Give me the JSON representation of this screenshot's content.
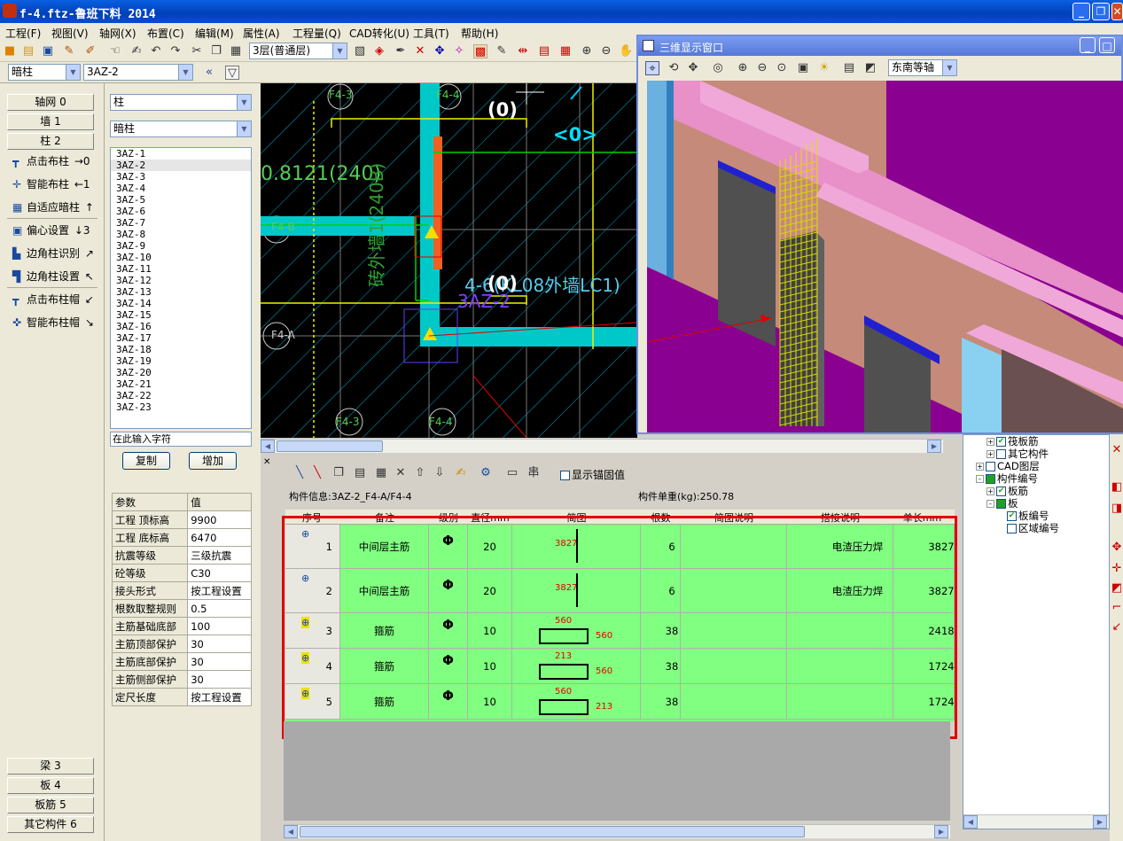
{
  "window": {
    "title": "f-4.ftz-鲁班下料 2014",
    "minimize": "_",
    "restore": "❐",
    "close": "✕"
  },
  "menu": [
    "工程(F)",
    "视图(V)",
    "轴网(X)",
    "布置(C)",
    "编辑(M)",
    "属性(A)",
    "工程量(Q)",
    "CAD转化(U)",
    "工具(T)",
    "帮助(H)"
  ],
  "toolbar": {
    "floor_select": "3层(普通层)"
  },
  "toolbar2": {
    "type_select": "暗柱",
    "name_select": "3AZ-2"
  },
  "left_nav": {
    "top": [
      {
        "label": "轴网 0"
      },
      {
        "label": "墙 1"
      },
      {
        "label": "柱 2"
      }
    ],
    "commands": [
      {
        "label": "点击布柱",
        "key": "→0"
      },
      {
        "label": "智能布柱",
        "key": "←1"
      },
      {
        "label": "自适应暗柱",
        "key": "↑"
      },
      {
        "label": "偏心设置",
        "key": "↓3"
      },
      {
        "label": "边角柱识别",
        "key": "↗"
      },
      {
        "label": "边角柱设置",
        "key": "↖"
      },
      {
        "label": "点击布柱帽",
        "key": "↙"
      },
      {
        "label": "智能布柱帽",
        "key": "↘"
      }
    ],
    "bottom": [
      {
        "label": "梁 3"
      },
      {
        "label": "板 4"
      },
      {
        "label": "板筋 5"
      },
      {
        "label": "其它构件 6"
      }
    ]
  },
  "component": {
    "category": "柱",
    "subtype": "暗柱",
    "list": [
      "3AZ-1",
      "3AZ-2",
      "3AZ-3",
      "3AZ-4",
      "3AZ-5",
      "3AZ-6",
      "3AZ-7",
      "3AZ-8",
      "3AZ-9",
      "3AZ-10",
      "3AZ-11",
      "3AZ-12",
      "3AZ-13",
      "3AZ-14",
      "3AZ-15",
      "3AZ-16",
      "3AZ-17",
      "3AZ-18",
      "3AZ-19",
      "3AZ-20",
      "3AZ-21",
      "3AZ-22",
      "3AZ-23"
    ],
    "selected_index": 1,
    "input_placeholder": "在此输入字符",
    "copy_button": "复制",
    "add_button": "增加"
  },
  "properties": {
    "header": [
      "参数",
      "值"
    ],
    "rows": [
      [
        "工程 顶标高",
        "9900"
      ],
      [
        "工程 底标高",
        "6470"
      ],
      [
        "抗震等级",
        "三级抗震"
      ],
      [
        "砼等级",
        "C30"
      ],
      [
        "接头形式",
        "按工程设置"
      ],
      [
        "根数取整规则",
        "0.5"
      ],
      [
        "主筋基础底部",
        "100"
      ],
      [
        "主筋顶部保护",
        "30"
      ],
      [
        "主筋底部保护",
        "30"
      ],
      [
        "主筋侧部保护",
        "30"
      ],
      [
        "定尺长度",
        "按工程设置"
      ]
    ]
  },
  "cad": {
    "labels": [
      "F4-3",
      "F4-4",
      "(0)",
      "<0>",
      "0.8121(240)",
      "砖外墙1(240B)",
      "F4-B",
      "4-6(KL08外墙LC1)",
      "(0)",
      "3AZ-2",
      "F4-A",
      "F4-3",
      "F4-4"
    ]
  },
  "view3d": {
    "title": "三维显示窗口",
    "view_select": "东南等轴"
  },
  "rebar": {
    "anchor_checkbox": "显示锚固值",
    "component_info": "构件信息:3AZ-2_F4-A/F4-4",
    "unit_weight": "构件单重(kg):250.78",
    "headers": [
      "序号",
      "备注",
      "级别",
      "直径mm",
      "简图",
      "根数",
      "简图说明",
      "搭接说明",
      "单长mm"
    ],
    "rows": [
      {
        "no": "1",
        "note": "中间层主筋",
        "grade": "Φ",
        "dia": "20",
        "shape_a": "3827",
        "shape_b": "",
        "count": "6",
        "desc": "",
        "lap": "电渣压力焊",
        "len": "3827"
      },
      {
        "no": "2",
        "note": "中间层主筋",
        "grade": "Φ",
        "dia": "20",
        "shape_a": "3827",
        "shape_b": "",
        "count": "6",
        "desc": "",
        "lap": "电渣压力焊",
        "len": "3827"
      },
      {
        "no": "3",
        "note": "箍筋",
        "grade": "Φ",
        "dia": "10",
        "shape_a": "560",
        "shape_b": "560",
        "count": "38",
        "desc": "",
        "lap": "",
        "len": "2418"
      },
      {
        "no": "4",
        "note": "箍筋",
        "grade": "Φ",
        "dia": "10",
        "shape_a": "213",
        "shape_b": "560",
        "count": "38",
        "desc": "",
        "lap": "",
        "len": "1724"
      },
      {
        "no": "5",
        "note": "箍筋",
        "grade": "Φ",
        "dia": "10",
        "shape_a": "560",
        "shape_b": "213",
        "count": "38",
        "desc": "",
        "lap": "",
        "len": "1724"
      }
    ]
  },
  "tree": [
    {
      "label": "筏板筋",
      "checked": true,
      "indent": 1,
      "expander": "+"
    },
    {
      "label": "其它构件",
      "checked": false,
      "indent": 1,
      "expander": "+"
    },
    {
      "label": "CAD图层",
      "checked": false,
      "indent": 0,
      "expander": "+"
    },
    {
      "label": "构件编号",
      "checked": true,
      "filled": true,
      "indent": 0,
      "expander": "-"
    },
    {
      "label": "板筋",
      "checked": true,
      "indent": 1,
      "expander": "+"
    },
    {
      "label": "板",
      "checked": true,
      "filled": true,
      "indent": 1,
      "expander": "-"
    },
    {
      "label": "板编号",
      "checked": true,
      "indent": 2,
      "expander": ""
    },
    {
      "label": "区域编号",
      "checked": false,
      "indent": 2,
      "expander": ""
    }
  ],
  "colors": {
    "title_blue": "#0040b8",
    "grid_green": "#80ff80",
    "red_highlight": "#e00000",
    "purple_bg": "#8a0090",
    "cyan_wall": "#00c8c8"
  }
}
